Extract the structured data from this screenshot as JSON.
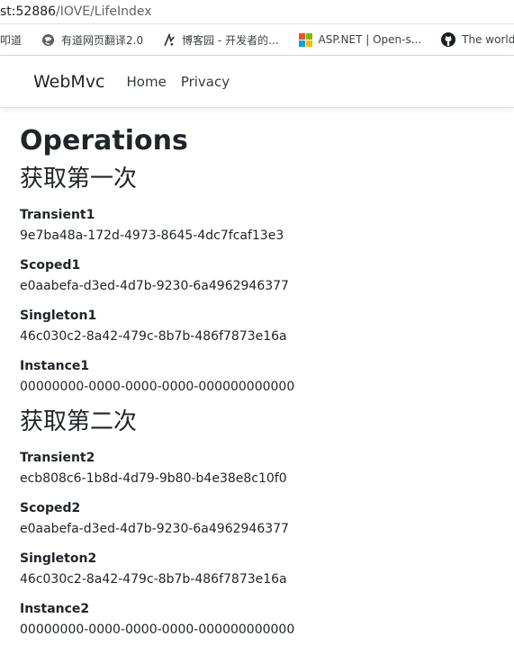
{
  "browser": {
    "url_host": "st:52886",
    "url_path": "/IOVE/LifeIndex",
    "bookmarks": [
      {
        "label": "叩道",
        "icon": "bookmark-icon"
      },
      {
        "label": "有道网页翻译2.0",
        "icon": "globe-icon"
      },
      {
        "label": "博客园 - 开发者的...",
        "icon": "cnblogs-icon"
      },
      {
        "label": "ASP.NET | Open-s...",
        "icon": "microsoft-icon"
      },
      {
        "label": "The world's le",
        "icon": "github-icon"
      }
    ]
  },
  "navbar": {
    "brand": "WebMvc",
    "links": [
      "Home",
      "Privacy"
    ]
  },
  "page": {
    "title": "Operations",
    "sections": [
      {
        "heading": "获取第一次",
        "items": [
          {
            "label": "Transient1",
            "value": "9e7ba48a-172d-4973-8645-4dc7fcaf13e3"
          },
          {
            "label": "Scoped1",
            "value": "e0aabefa-d3ed-4d7b-9230-6a4962946377"
          },
          {
            "label": "Singleton1",
            "value": "46c030c2-8a42-479c-8b7b-486f7873e16a"
          },
          {
            "label": "Instance1",
            "value": "00000000-0000-0000-0000-000000000000"
          }
        ]
      },
      {
        "heading": "获取第二次",
        "items": [
          {
            "label": "Transient2",
            "value": "ecb808c6-1b8d-4d79-9b80-b4e38e8c10f0"
          },
          {
            "label": "Scoped2",
            "value": "e0aabefa-d3ed-4d7b-9230-6a4962946377"
          },
          {
            "label": "Singleton2",
            "value": "46c030c2-8a42-479c-8b7b-486f7873e16a"
          },
          {
            "label": "Instance2",
            "value": "00000000-0000-0000-0000-000000000000"
          }
        ]
      }
    ]
  }
}
